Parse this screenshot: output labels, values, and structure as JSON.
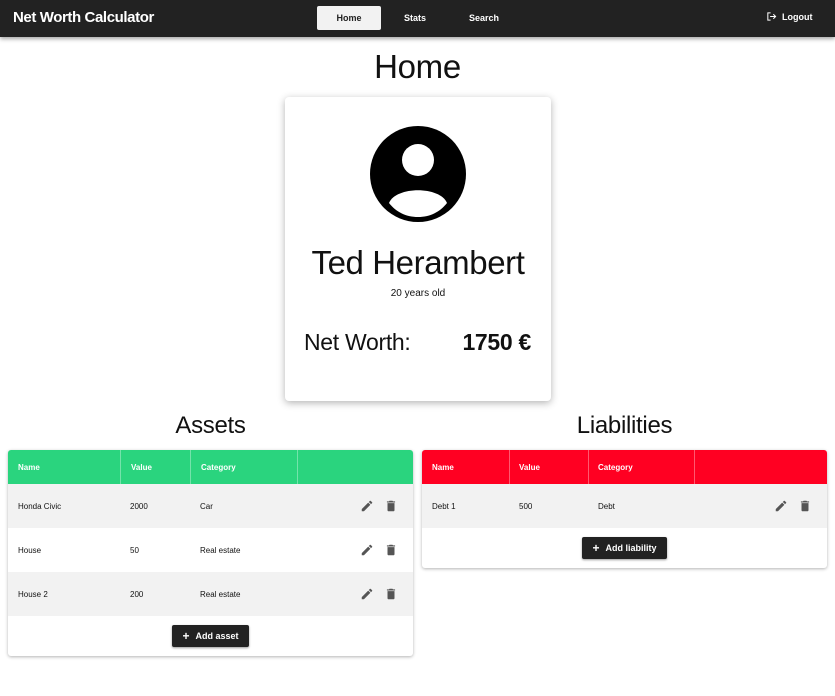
{
  "header": {
    "app_title": "Net Worth Calculator",
    "nav": {
      "home": "Home",
      "stats": "Stats",
      "search": "Search"
    },
    "logout": "Logout"
  },
  "page_title": "Home",
  "profile": {
    "name": "Ted Herambert",
    "age": "20 years old",
    "net_worth_label": "Net Worth:",
    "net_worth_value": "1750 €"
  },
  "assets": {
    "title": "Assets",
    "columns": {
      "name": "Name",
      "value": "Value",
      "category": "Category"
    },
    "rows": [
      {
        "name": "Honda Civic",
        "value": "2000",
        "category": "Car"
      },
      {
        "name": "House",
        "value": "50",
        "category": "Real estate"
      },
      {
        "name": "House 2",
        "value": "200",
        "category": "Real estate"
      }
    ],
    "add_label": "Add asset",
    "header_color": "#2ad47e"
  },
  "liabilities": {
    "title": "Liabilities",
    "columns": {
      "name": "Name",
      "value": "Value",
      "category": "Category"
    },
    "rows": [
      {
        "name": "Debt 1",
        "value": "500",
        "category": "Debt"
      }
    ],
    "add_label": "Add liability",
    "header_color": "#ff0022"
  },
  "icons": {
    "edit": "pencil-icon",
    "delete": "trash-icon",
    "logout": "logout-icon",
    "avatar": "account-circle-icon",
    "add": "plus-icon"
  }
}
